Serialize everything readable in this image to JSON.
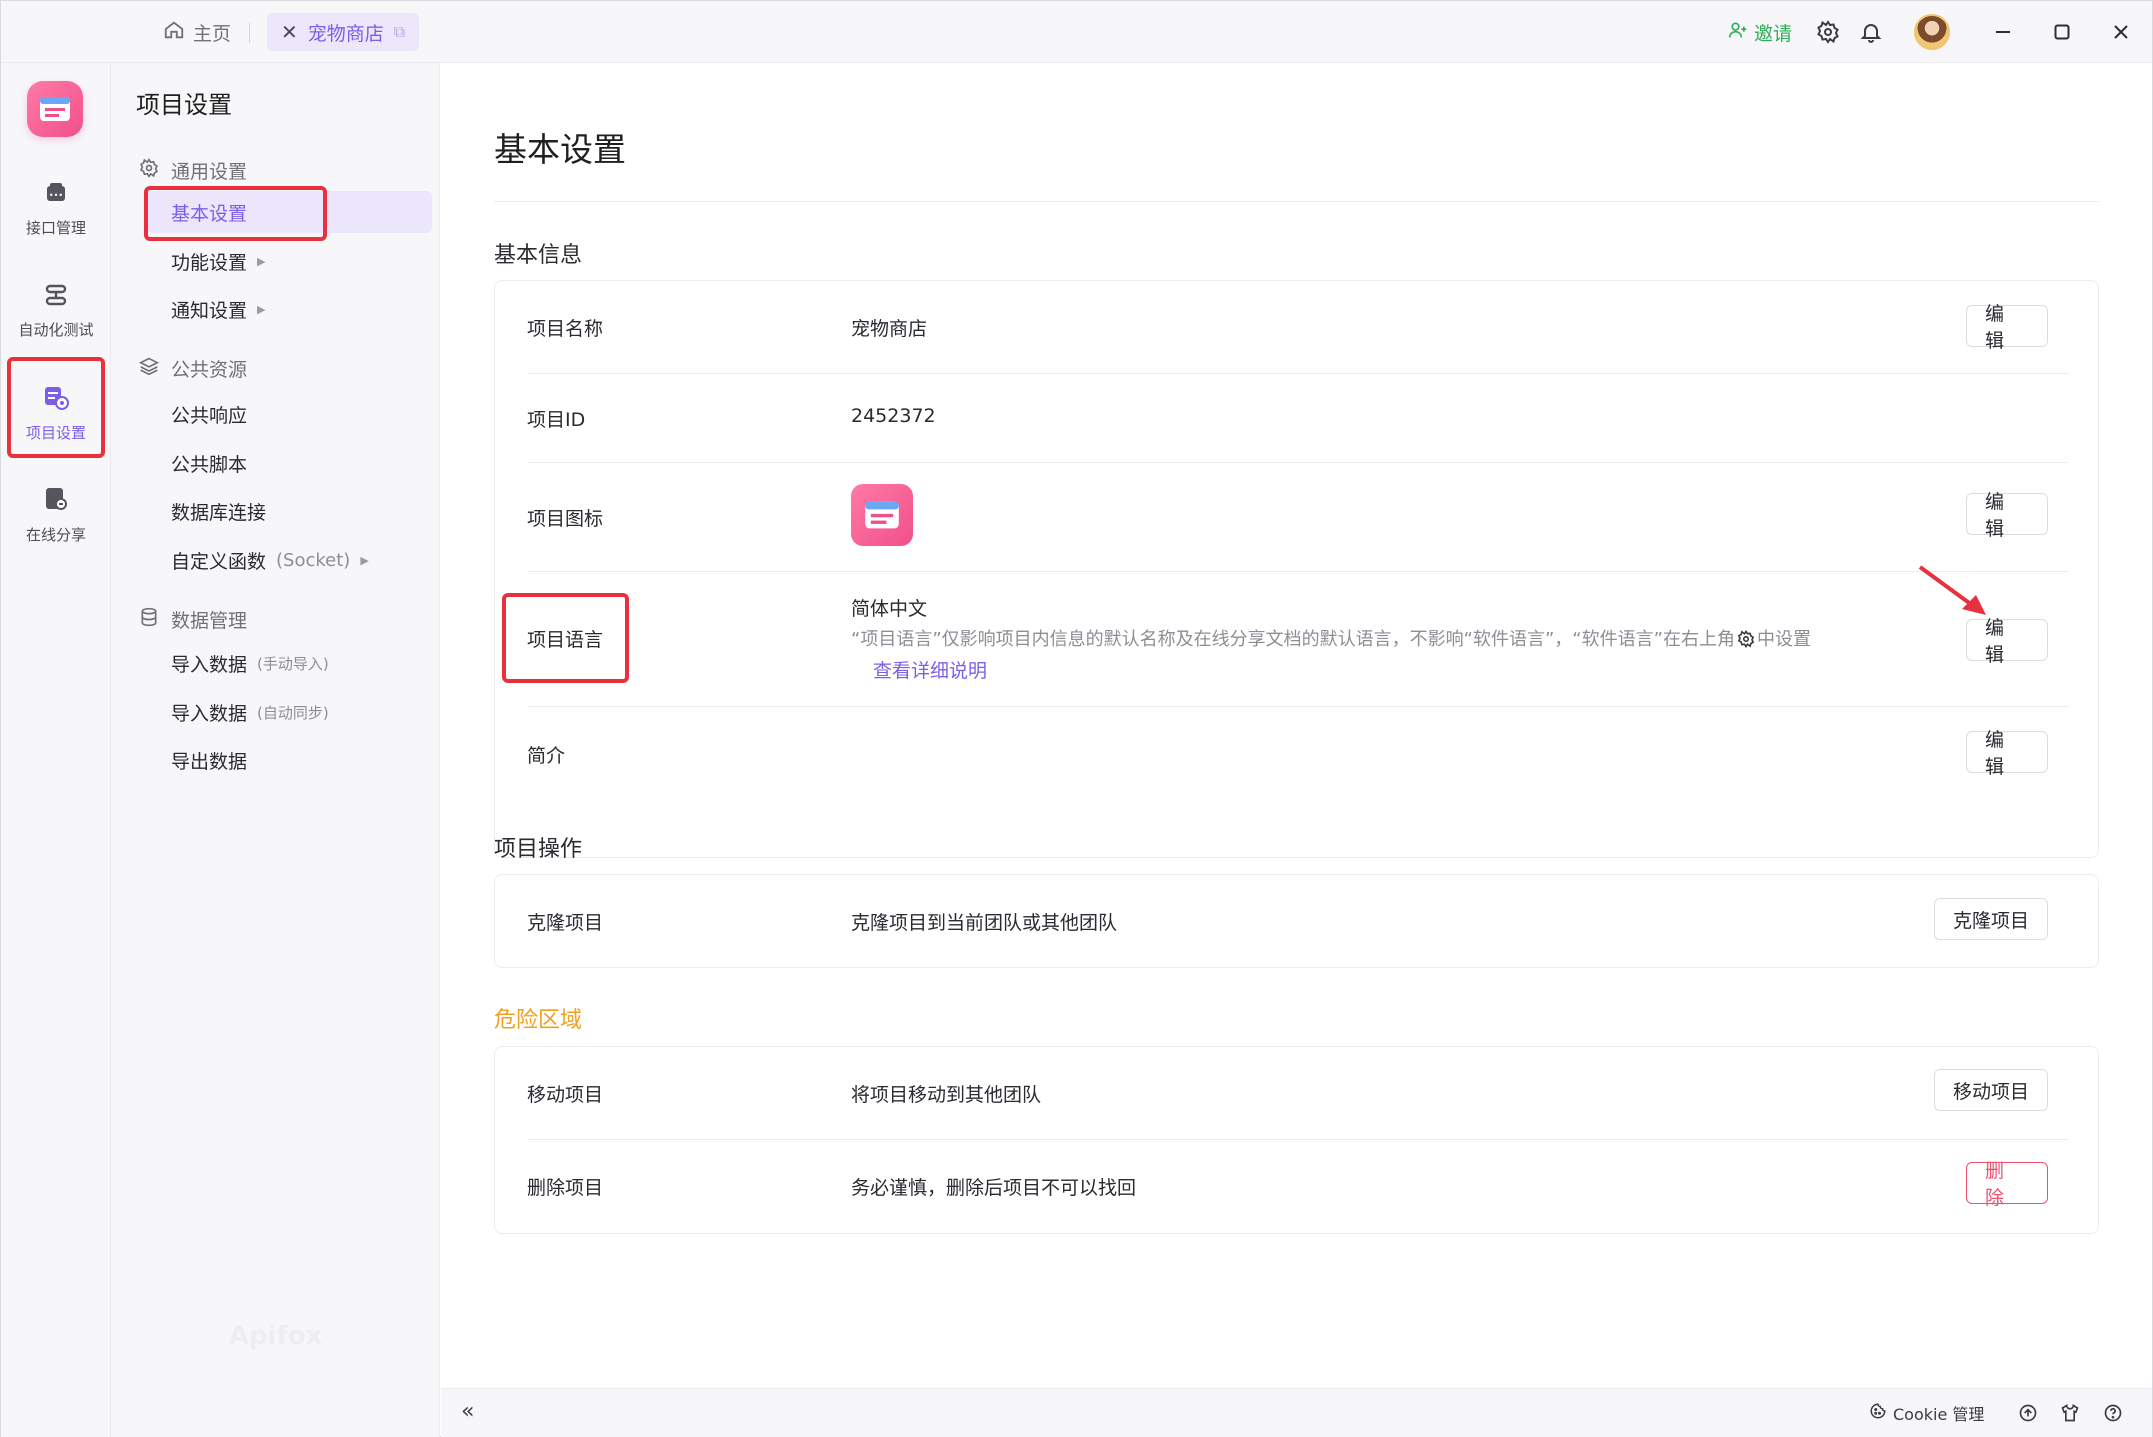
{
  "titlebar": {
    "home_tab": "主页",
    "active_tab": "宠物商店",
    "invite": "邀请"
  },
  "rail": {
    "items": [
      {
        "label": "接口管理",
        "icon": "api-management-icon"
      },
      {
        "label": "自动化测试",
        "icon": "automation-test-icon"
      },
      {
        "label": "项目设置",
        "icon": "project-settings-icon"
      },
      {
        "label": "在线分享",
        "icon": "online-share-icon"
      }
    ]
  },
  "subsidebar": {
    "title": "项目设置",
    "groups": [
      {
        "label": "通用设置",
        "icon": "gear-icon",
        "items": [
          {
            "label": "基本设置"
          },
          {
            "label": "功能设置"
          },
          {
            "label": "通知设置"
          }
        ]
      },
      {
        "label": "公共资源",
        "icon": "layers-icon",
        "items": [
          {
            "label": "公共响应"
          },
          {
            "label": "公共脚本"
          },
          {
            "label": "数据库连接"
          },
          {
            "label": "自定义函数",
            "suffix": "(Socket)"
          }
        ]
      },
      {
        "label": "数据管理",
        "icon": "database-icon",
        "items": [
          {
            "label": "导入数据",
            "suffix": "(手动导入)"
          },
          {
            "label": "导入数据",
            "suffix": "(自动同步)"
          },
          {
            "label": "导出数据"
          }
        ]
      }
    ],
    "watermark": "Apifox"
  },
  "main": {
    "title": "基本设置",
    "basic_info": {
      "title": "基本信息",
      "rows": [
        {
          "label": "项目名称",
          "value": "宠物商店",
          "button": "编 辑"
        },
        {
          "label": "项目ID",
          "value": "2452372"
        },
        {
          "label": "项目图标",
          "button": "编 辑"
        },
        {
          "label": "项目语言",
          "value": "简体中文",
          "note": "“项目语言”仅影响项目内信息的默认名称及在线分享文档的默认语言，不影响“软件语言”，“软件语言”在右上角",
          "note_tail": "中设置",
          "link": "查看详细说明",
          "button": "编 辑"
        },
        {
          "label": "简介",
          "button": "编 辑"
        }
      ]
    },
    "operations": {
      "title": "项目操作",
      "rows": [
        {
          "label": "克隆项目",
          "value": "克隆项目到当前团队或其他团队",
          "button": "克隆项目"
        }
      ]
    },
    "danger": {
      "title": "危险区域",
      "rows": [
        {
          "label": "移动项目",
          "value": "将项目移动到其他团队",
          "button": "移动项目"
        },
        {
          "label": "删除项目",
          "value": "务必谨慎，删除后项目不可以找回",
          "button": "删 除"
        }
      ]
    }
  },
  "statusbar": {
    "cookie": "Cookie 管理"
  },
  "colors": {
    "accent": "#7d5ee8",
    "danger": "#f0506e",
    "warning_title": "#f0a020",
    "invite": "#2fae5a",
    "highlight": "#e8303f"
  }
}
